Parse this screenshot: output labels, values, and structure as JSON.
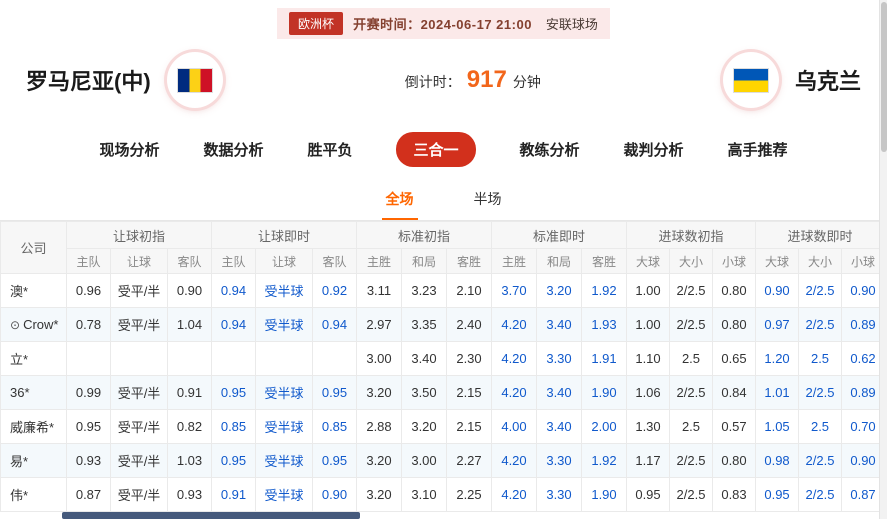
{
  "header": {
    "league_badge": "欧洲杯",
    "kickoff": "开赛时间：2024-06-17 21:00",
    "venue": "安联球场",
    "home_team": "罗马尼亚(中)",
    "away_team": "乌克兰",
    "countdown_label": "倒计时：",
    "countdown_value": "917",
    "countdown_unit": "分钟"
  },
  "nav": {
    "tabs": [
      {
        "label": "现场分析",
        "active": false
      },
      {
        "label": "数据分析",
        "active": false
      },
      {
        "label": "胜平负",
        "active": false
      },
      {
        "label": "三合一",
        "active": true
      },
      {
        "label": "教练分析",
        "active": false
      },
      {
        "label": "裁判分析",
        "active": false
      },
      {
        "label": "高手推荐",
        "active": false
      }
    ]
  },
  "subtabs": [
    {
      "label": "全场",
      "active": true
    },
    {
      "label": "半场",
      "active": false
    }
  ],
  "table": {
    "company_header": "公司",
    "groups": [
      "让球初指",
      "让球即时",
      "标准初指",
      "标准即时",
      "进球数初指",
      "进球数即时"
    ],
    "sub_headers": [
      "主队",
      "让球",
      "客队",
      "主队",
      "让球",
      "客队",
      "主胜",
      "和局",
      "客胜",
      "主胜",
      "和局",
      "客胜",
      "大球",
      "大小",
      "小球",
      "大球",
      "大小",
      "小球"
    ],
    "live_column_indexes": [
      3,
      4,
      5,
      9,
      10,
      11,
      15,
      16,
      17
    ],
    "rows": [
      {
        "name": "澳*",
        "icon": "",
        "cells": [
          "0.96",
          "受平/半",
          "0.90",
          "0.94",
          "受半球",
          "0.92",
          "3.11",
          "3.23",
          "2.10",
          "3.70",
          "3.20",
          "1.92",
          "1.00",
          "2/2.5",
          "0.80",
          "0.90",
          "2/2.5",
          "0.90"
        ]
      },
      {
        "name": "Crow*",
        "icon": "⊙",
        "cells": [
          "0.78",
          "受平/半",
          "1.04",
          "0.94",
          "受半球",
          "0.94",
          "2.97",
          "3.35",
          "2.40",
          "4.20",
          "3.40",
          "1.93",
          "1.00",
          "2/2.5",
          "0.80",
          "0.97",
          "2/2.5",
          "0.89"
        ]
      },
      {
        "name": "立*",
        "icon": "",
        "cells": [
          "",
          "",
          "",
          "",
          "",
          "",
          "3.00",
          "3.40",
          "2.30",
          "4.20",
          "3.30",
          "1.91",
          "1.10",
          "2.5",
          "0.65",
          "1.20",
          "2.5",
          "0.62"
        ]
      },
      {
        "name": "36*",
        "icon": "",
        "cells": [
          "0.99",
          "受平/半",
          "0.91",
          "0.95",
          "受半球",
          "0.95",
          "3.20",
          "3.50",
          "2.15",
          "4.20",
          "3.40",
          "1.90",
          "1.06",
          "2/2.5",
          "0.84",
          "1.01",
          "2/2.5",
          "0.89"
        ]
      },
      {
        "name": "威廉希*",
        "icon": "",
        "cells": [
          "0.95",
          "受平/半",
          "0.82",
          "0.85",
          "受半球",
          "0.85",
          "2.88",
          "3.20",
          "2.15",
          "4.00",
          "3.40",
          "2.00",
          "1.30",
          "2.5",
          "0.57",
          "1.05",
          "2.5",
          "0.70"
        ]
      },
      {
        "name": "易*",
        "icon": "",
        "cells": [
          "0.93",
          "受平/半",
          "1.03",
          "0.95",
          "受半球",
          "0.95",
          "3.20",
          "3.00",
          "2.27",
          "4.20",
          "3.30",
          "1.92",
          "1.17",
          "2/2.5",
          "0.80",
          "0.98",
          "2/2.5",
          "0.90"
        ]
      },
      {
        "name": "伟*",
        "icon": "",
        "cells": [
          "0.87",
          "受平/半",
          "0.93",
          "0.91",
          "受半球",
          "0.90",
          "3.20",
          "3.10",
          "2.25",
          "4.20",
          "3.30",
          "1.90",
          "0.95",
          "2/2.5",
          "0.83",
          "0.95",
          "2/2.5",
          "0.87"
        ]
      }
    ]
  },
  "colors": {
    "accent_red": "#d2301c",
    "accent_orange": "#ff6600",
    "live_blue": "#1059cc",
    "strip_pink": "#fbe9e9"
  }
}
